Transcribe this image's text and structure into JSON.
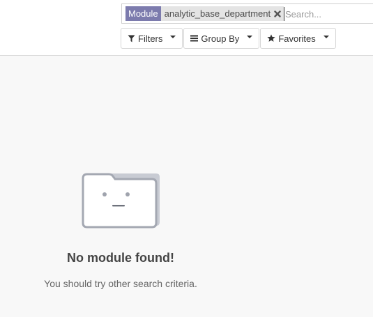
{
  "search": {
    "facet_label": "Module",
    "facet_value": "analytic_base_department",
    "placeholder": "Search..."
  },
  "toolbar": {
    "filters_label": "Filters",
    "groupby_label": "Group By",
    "favorites_label": "Favorites"
  },
  "empty_state": {
    "title": "No module found!",
    "subtitle": "You should try other search criteria."
  },
  "icons": {
    "filters": "filter-icon",
    "groupby": "bars-icon",
    "favorites": "star-icon",
    "facet_remove": "close-icon",
    "empty": "sad-folder-icon"
  },
  "colors": {
    "facet_label_bg": "#7c7bad",
    "facet_value_bg": "#e4e4e4",
    "background": "#f8f8f8"
  }
}
